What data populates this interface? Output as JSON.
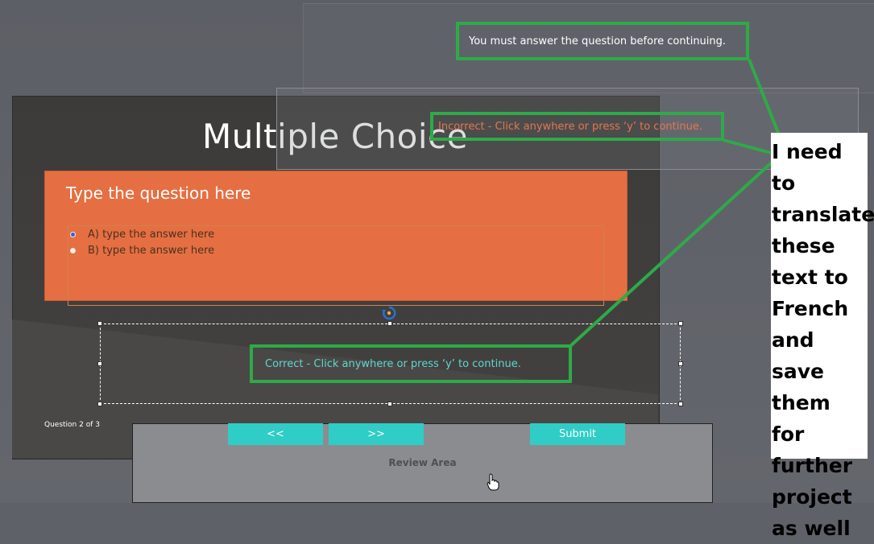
{
  "slide": {
    "title": "Multiple Choice",
    "question": "Type the question here",
    "answers": [
      {
        "label": "A) type the answer here",
        "selected": true
      },
      {
        "label": "B) type the answer here",
        "selected": false
      }
    ],
    "counter": "Question 2 of 3"
  },
  "feedback": {
    "must_answer": "You must answer the question before continuing.",
    "incorrect": "Incorrect - Click anywhere or press ‘y’ to continue.",
    "correct": "Correct - Click anywhere or press ‘y’ to continue."
  },
  "buttons": {
    "prev": "<<",
    "next": ">>",
    "submit": "Submit"
  },
  "review": {
    "label": "Review Area"
  },
  "annotation": {
    "lines": [
      "I need to",
      "translate",
      "these",
      "text to",
      "French",
      "and save",
      "them for",
      "further",
      "project",
      "as well"
    ]
  },
  "colors": {
    "highlight": "#2eaa48",
    "accent_button": "#2fcdc6",
    "question_bg": "#e56f42",
    "correct_text": "#5fd7d2",
    "incorrect_text": "#e2784d"
  }
}
